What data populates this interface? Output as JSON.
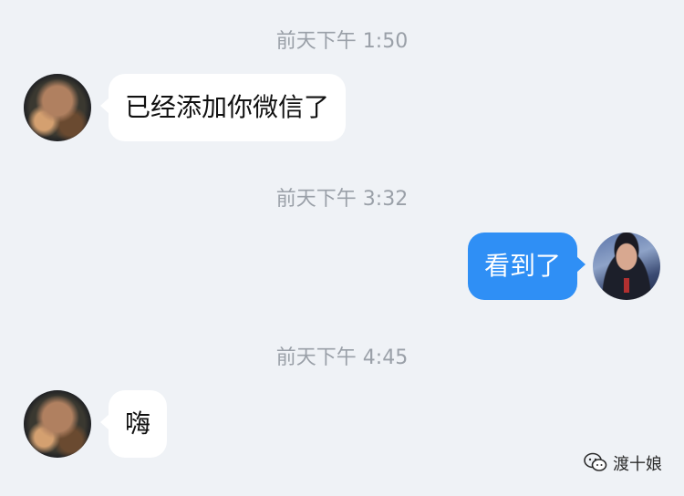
{
  "messages": [
    {
      "timestamp": "前天下午 1:50",
      "side": "left",
      "text": "已经添加你微信了"
    },
    {
      "timestamp": "前天下午 3:32",
      "side": "right",
      "text": "看到了"
    },
    {
      "timestamp": "前天下午 4:45",
      "side": "left",
      "text": "嗨"
    }
  ],
  "watermark": {
    "text": "渡十娘",
    "icon": "wechat-icon"
  },
  "colors": {
    "background": "#eff2f6",
    "incoming_bubble": "#ffffff",
    "outgoing_bubble": "#2f8ff5",
    "timestamp_text": "#9aa0a8"
  }
}
